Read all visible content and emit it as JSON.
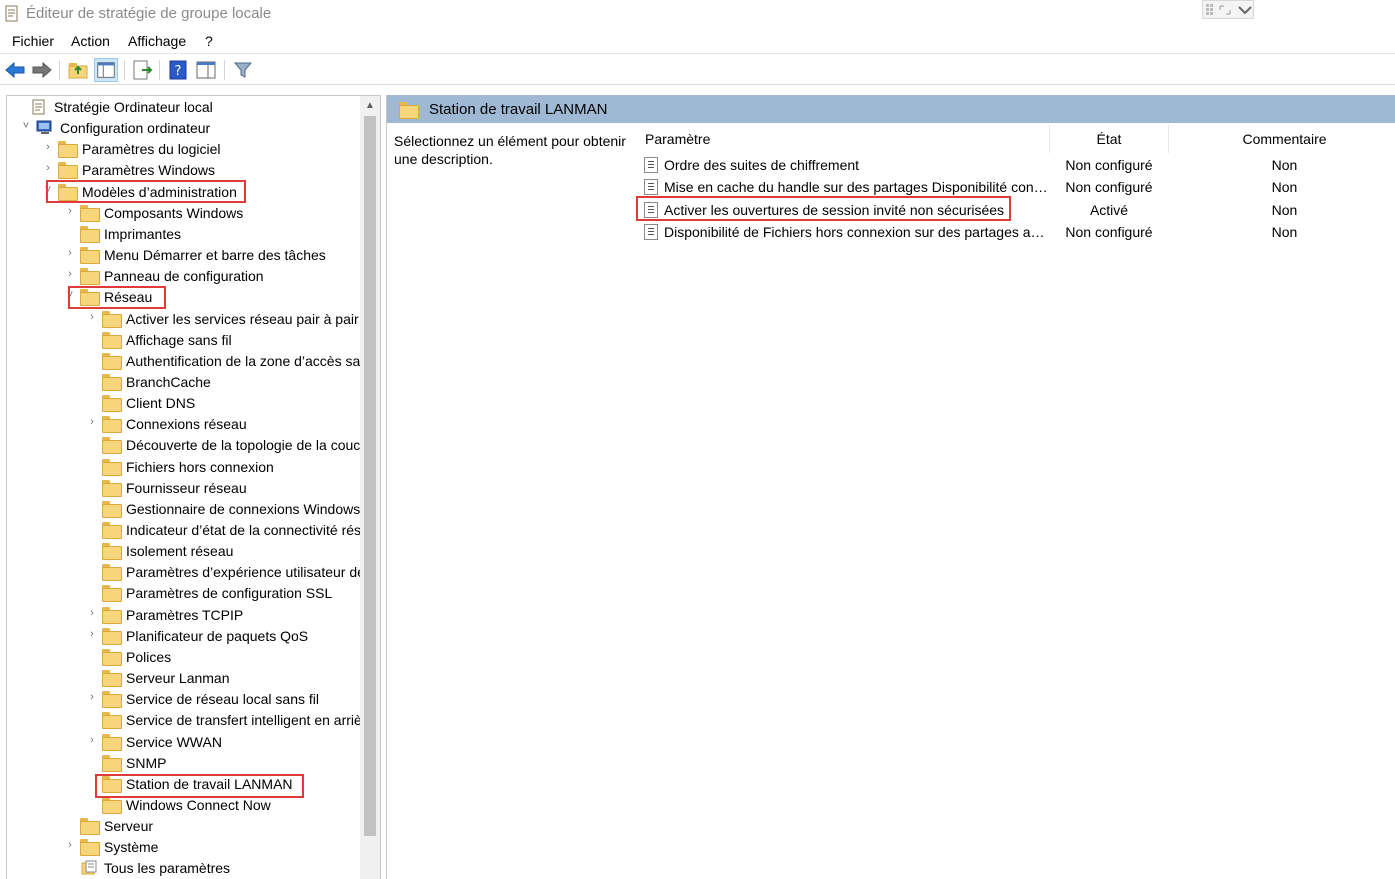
{
  "window": {
    "title": "Éditeur de stratégie de groupe locale"
  },
  "menu": {
    "items": [
      "Fichier",
      "Action",
      "Affichage",
      "?"
    ]
  },
  "tree": {
    "items": [
      {
        "label": "Stratégie Ordinateur local",
        "level": 0,
        "chevron": "",
        "icon": "policy-icon"
      },
      {
        "label": "Configuration ordinateur",
        "level": 1,
        "chevron": "˅",
        "icon": "computer-icon"
      },
      {
        "label": "Paramètres du logiciel",
        "level": 2,
        "chevron": "›",
        "icon": "folder-icon"
      },
      {
        "label": "Paramètres Windows",
        "level": 2,
        "chevron": "›",
        "icon": "folder-icon"
      },
      {
        "label": "Modèles d’administration",
        "level": 2,
        "chevron": "˅",
        "icon": "folder-icon"
      },
      {
        "label": "Composants Windows",
        "level": 3,
        "chevron": "›",
        "icon": "folder-icon"
      },
      {
        "label": "Imprimantes",
        "level": 3,
        "chevron": "",
        "icon": "folder-icon"
      },
      {
        "label": "Menu Démarrer et barre des tâches",
        "level": 3,
        "chevron": "›",
        "icon": "folder-icon"
      },
      {
        "label": "Panneau de configuration",
        "level": 3,
        "chevron": "›",
        "icon": "folder-icon"
      },
      {
        "label": "Réseau",
        "level": 3,
        "chevron": "˅",
        "icon": "folder-icon"
      },
      {
        "label": "Activer les services réseau pair à pair Microsoft",
        "level": 4,
        "chevron": "›",
        "icon": "folder-icon"
      },
      {
        "label": "Affichage sans fil",
        "level": 4,
        "chevron": "",
        "icon": "folder-icon"
      },
      {
        "label": "Authentification de la zone d’accès sans fil",
        "level": 4,
        "chevron": "",
        "icon": "folder-icon"
      },
      {
        "label": "BranchCache",
        "level": 4,
        "chevron": "",
        "icon": "folder-icon"
      },
      {
        "label": "Client DNS",
        "level": 4,
        "chevron": "",
        "icon": "folder-icon"
      },
      {
        "label": "Connexions réseau",
        "level": 4,
        "chevron": "›",
        "icon": "folder-icon"
      },
      {
        "label": "Découverte de la topologie de la couche de liaison",
        "level": 4,
        "chevron": "",
        "icon": "folder-icon"
      },
      {
        "label": "Fichiers hors connexion",
        "level": 4,
        "chevron": "",
        "icon": "folder-icon"
      },
      {
        "label": "Fournisseur réseau",
        "level": 4,
        "chevron": "",
        "icon": "folder-icon"
      },
      {
        "label": "Gestionnaire de connexions Windows",
        "level": 4,
        "chevron": "",
        "icon": "folder-icon"
      },
      {
        "label": "Indicateur d’état de la connectivité réseau",
        "level": 4,
        "chevron": "",
        "icon": "folder-icon"
      },
      {
        "label": "Isolement réseau",
        "level": 4,
        "chevron": "",
        "icon": "folder-icon"
      },
      {
        "label": "Paramètres d’expérience utilisateur des fichiers",
        "level": 4,
        "chevron": "",
        "icon": "folder-icon"
      },
      {
        "label": "Paramètres de configuration SSL",
        "level": 4,
        "chevron": "",
        "icon": "folder-icon"
      },
      {
        "label": "Paramètres TCPIP",
        "level": 4,
        "chevron": "›",
        "icon": "folder-icon"
      },
      {
        "label": "Planificateur de paquets QoS",
        "level": 4,
        "chevron": "›",
        "icon": "folder-icon"
      },
      {
        "label": "Polices",
        "level": 4,
        "chevron": "",
        "icon": "folder-icon"
      },
      {
        "label": "Serveur Lanman",
        "level": 4,
        "chevron": "",
        "icon": "folder-icon"
      },
      {
        "label": "Service de réseau local sans fil",
        "level": 4,
        "chevron": "›",
        "icon": "folder-icon"
      },
      {
        "label": "Service de transfert intelligent en arrière-plan",
        "level": 4,
        "chevron": "",
        "icon": "folder-icon"
      },
      {
        "label": "Service WWAN",
        "level": 4,
        "chevron": "›",
        "icon": "folder-icon"
      },
      {
        "label": "SNMP",
        "level": 4,
        "chevron": "",
        "icon": "folder-icon"
      },
      {
        "label": "Station de travail LANMAN",
        "level": 4,
        "chevron": "",
        "icon": "folder-icon"
      },
      {
        "label": "Windows Connect Now",
        "level": 4,
        "chevron": "",
        "icon": "folder-icon"
      },
      {
        "label": "Serveur",
        "level": 3,
        "chevron": "",
        "icon": "folder-icon"
      },
      {
        "label": "Système",
        "level": 3,
        "chevron": "›",
        "icon": "folder-icon"
      },
      {
        "label": "Tous les paramètres",
        "level": 3,
        "chevron": "",
        "icon": "settings-icon"
      }
    ]
  },
  "right": {
    "header_title": "Station de travail LANMAN",
    "description": "Sélectionnez un élément pour obtenir une description.",
    "columns": {
      "name": "Paramètre",
      "state": "État",
      "comment": "Commentaire"
    },
    "rows": [
      {
        "name": "Ordre des suites de chiffrement",
        "state": "Non configuré",
        "comment": "Non"
      },
      {
        "name": "Mise en cache du handle sur des partages Disponibilité continue",
        "state": "Non configuré",
        "comment": "Non"
      },
      {
        "name": "Activer les ouvertures de session invité non sécurisées",
        "state": "Activé",
        "comment": "Non"
      },
      {
        "name": "Disponibilité de Fichiers hors connexion sur des partages avec disponibilité continue",
        "state": "Non configuré",
        "comment": "Non"
      }
    ]
  },
  "colors": {
    "highlight": "#e03a3a",
    "header_bg": "#9fb8d4",
    "folder": "#f7d57a"
  }
}
